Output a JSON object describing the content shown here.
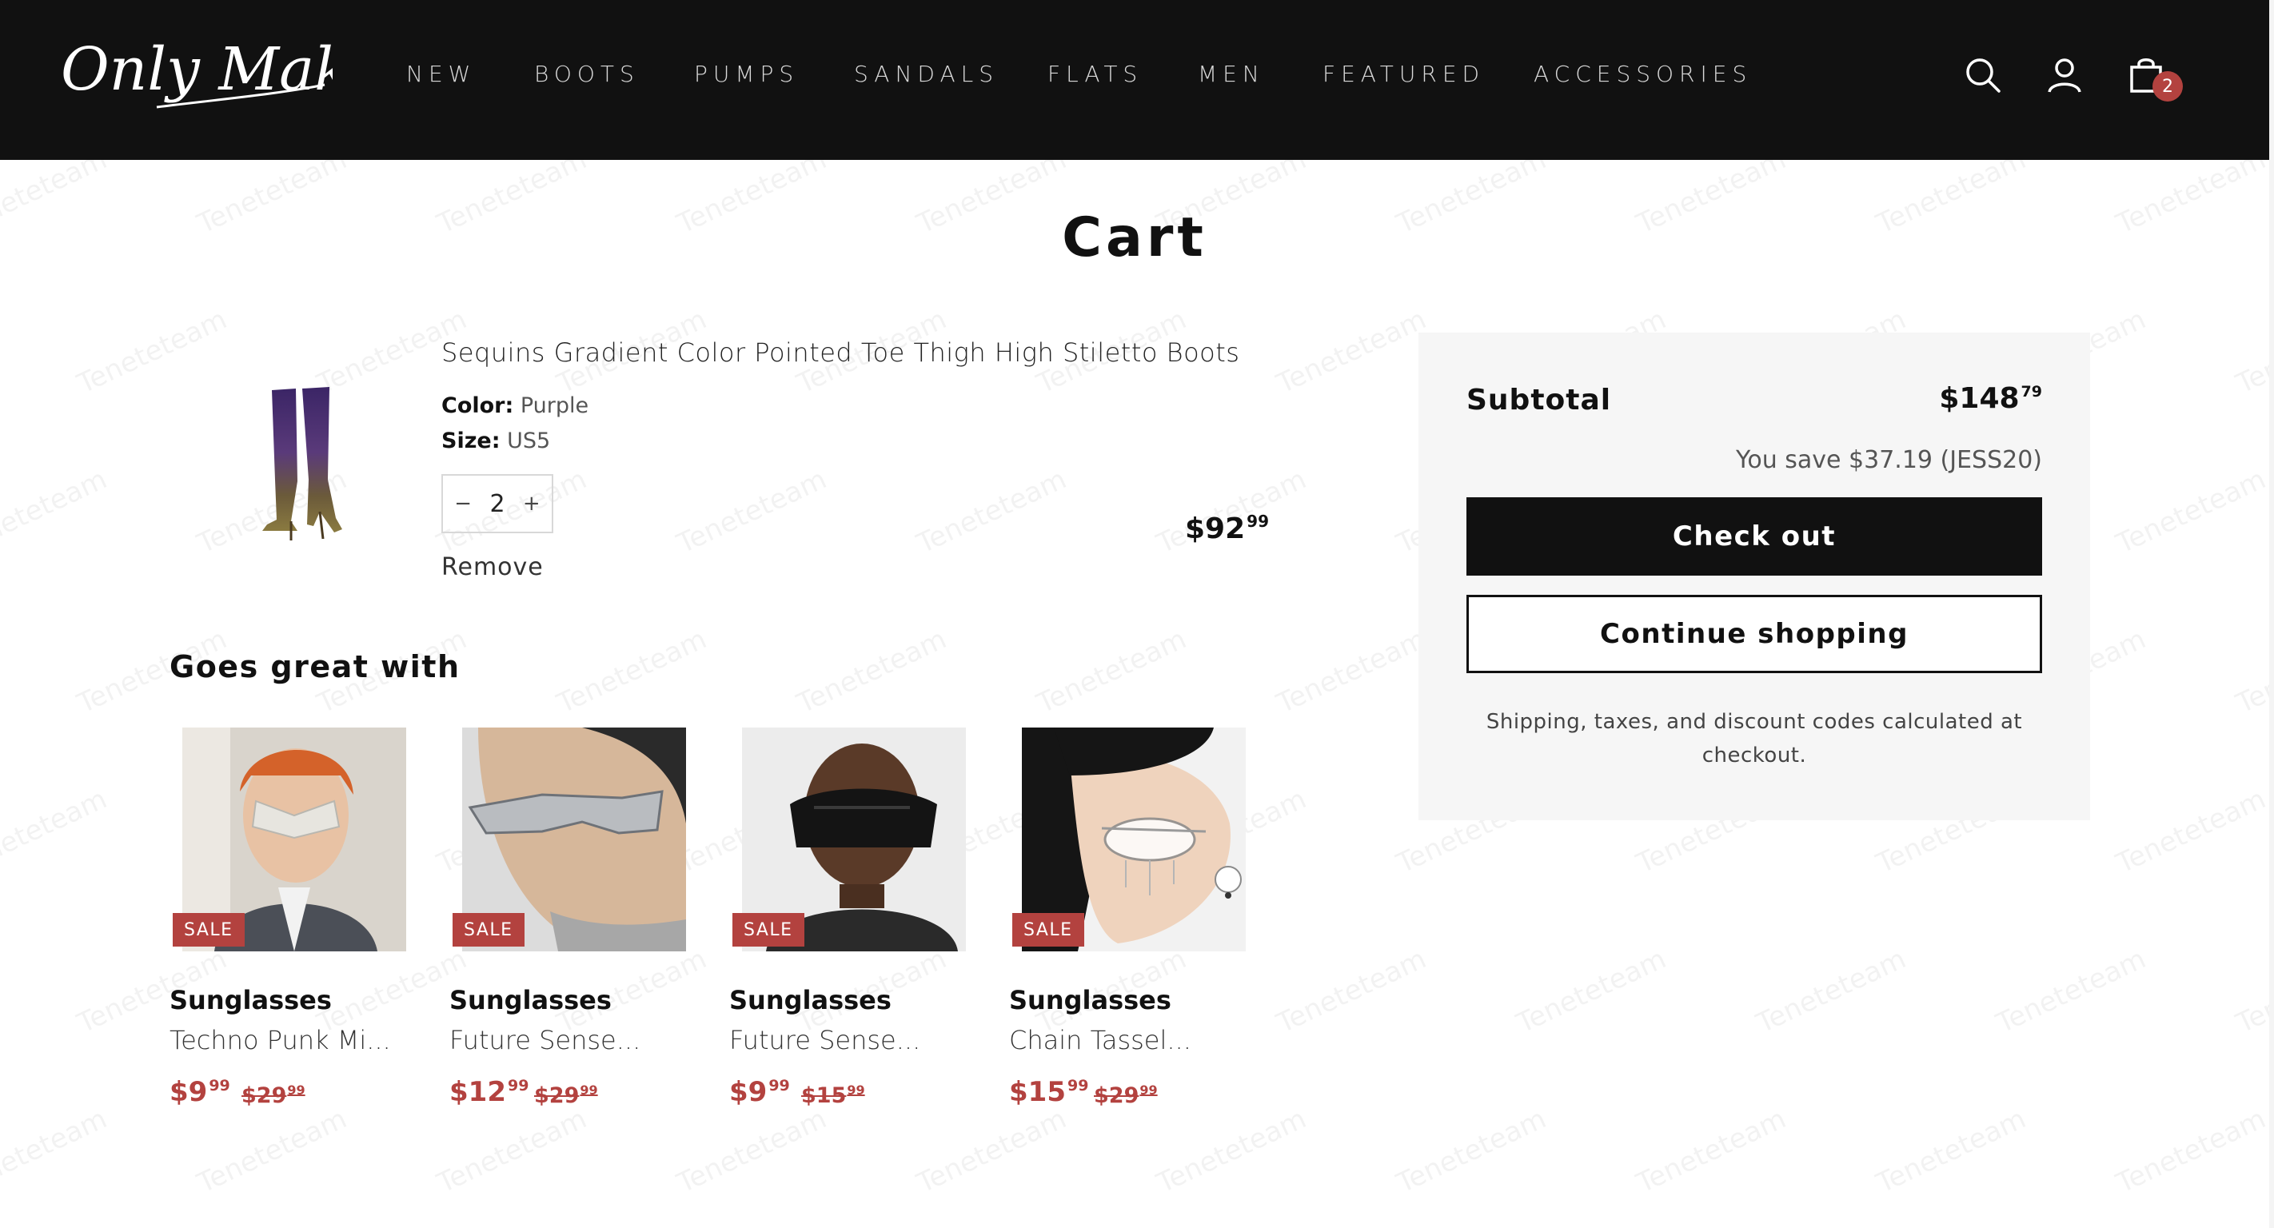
{
  "brand": {
    "logo_text": "Only Maker"
  },
  "nav": {
    "items": [
      "NEW",
      "BOOTS",
      "PUMPS",
      "SANDALS",
      "FLATS",
      "MEN",
      "FEATURED",
      "ACCESSORIES"
    ]
  },
  "header_icons": {
    "search": "search-icon",
    "account": "account-icon",
    "cart": "cart-icon",
    "cart_count": "2"
  },
  "page": {
    "title": "Cart"
  },
  "watermark": "Teneteteam",
  "cart_item": {
    "title": "Sequins Gradient Color Pointed Toe Thigh High Stiletto Boots",
    "color_label": "Color:",
    "color_value": "Purple",
    "size_label": "Size:",
    "size_value": "US5",
    "qty_minus": "−",
    "qty": "2",
    "qty_plus": "+",
    "remove": "Remove",
    "price_main": "$92",
    "price_cents": "99"
  },
  "recommendations": {
    "title": "Goes great with",
    "sale_label": "SALE",
    "items": [
      {
        "name": "Sunglasses",
        "subtitle": "Techno Punk Mi...",
        "price_main": "$9",
        "price_cents": "99",
        "orig_main": "$29",
        "orig_cents": "99"
      },
      {
        "name": "Sunglasses",
        "subtitle": "Future Sense...",
        "price_main": "$12",
        "price_cents": "99",
        "orig_main": "$29",
        "orig_cents": "99"
      },
      {
        "name": "Sunglasses",
        "subtitle": "Future Sense...",
        "price_main": "$9",
        "price_cents": "99",
        "orig_main": "$15",
        "orig_cents": "99"
      },
      {
        "name": "Sunglasses",
        "subtitle": "Chain Tassel...",
        "price_main": "$15",
        "price_cents": "99",
        "orig_main": "$29",
        "orig_cents": "99"
      }
    ]
  },
  "summary": {
    "subtotal_label": "Subtotal",
    "subtotal_main": "$148",
    "subtotal_cents": "79",
    "savings": "You save $37.19 (JESS20)",
    "checkout_label": "Check out",
    "continue_label": "Continue shopping",
    "note": "Shipping, taxes, and discount codes calculated at checkout."
  },
  "colors": {
    "header_bg": "#111111",
    "accent_sale": "#b3423f",
    "panel_bg": "#f6f6f6"
  }
}
